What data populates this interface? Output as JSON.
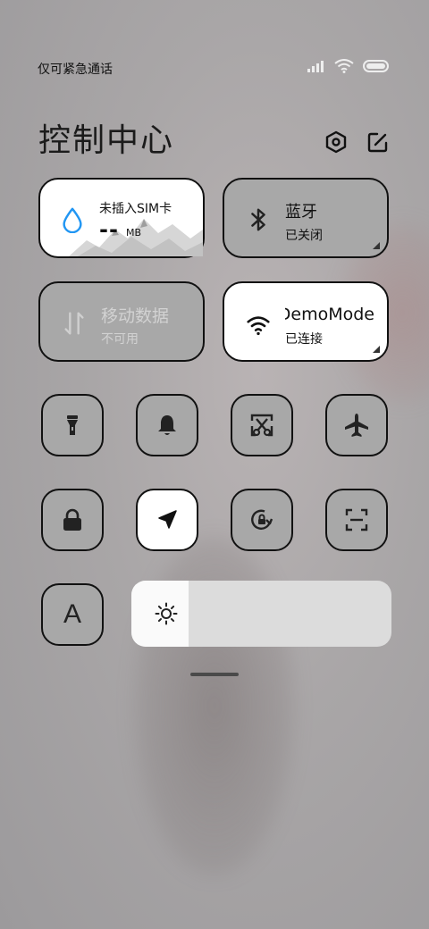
{
  "status_bar": {
    "carrier_text": "仅可紧急通话"
  },
  "header": {
    "title": "控制中心"
  },
  "tiles": {
    "sim": {
      "label": "未插入SIM卡",
      "data_value": "--",
      "data_unit": "MB"
    },
    "bluetooth": {
      "label": "蓝牙",
      "status": "已关闭"
    },
    "mobile_data": {
      "label": "移动数据",
      "status": "不可用"
    },
    "wifi": {
      "network_name": "DemoMode",
      "status": "已连接"
    }
  },
  "toggles": [
    {
      "icon": "flashlight-icon",
      "active": false
    },
    {
      "icon": "bell-icon",
      "active": false
    },
    {
      "icon": "screenshot-icon",
      "active": false
    },
    {
      "icon": "airplane-icon",
      "active": false
    },
    {
      "icon": "lock-icon",
      "active": false
    },
    {
      "icon": "location-icon",
      "active": true
    },
    {
      "icon": "rotation-lock-icon",
      "active": false
    },
    {
      "icon": "scan-icon",
      "active": false
    },
    {
      "icon": "font-size-icon",
      "active": false
    }
  ],
  "font_button": {
    "label": "A"
  },
  "brightness": {
    "level": 0.22
  },
  "colors": {
    "accent_blue": "#2196f3",
    "tile_white": "#ffffff",
    "tile_gray": "#a8a8a8"
  }
}
